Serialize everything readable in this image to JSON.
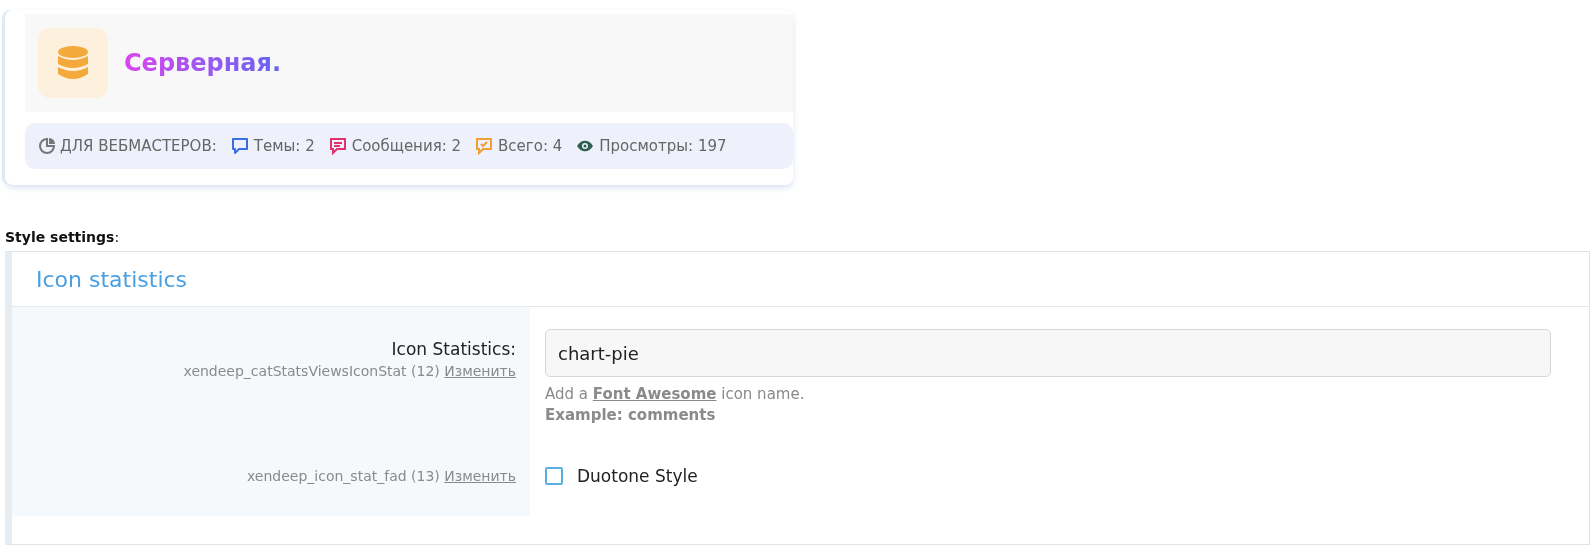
{
  "example": {
    "title": "Серверная.",
    "stats": [
      {
        "kind": "section",
        "label": "ДЛЯ ВЕБМАСТЕРОВ:",
        "color": "#777777"
      },
      {
        "kind": "topics",
        "label": "Темы: 2",
        "color": "#3b6fe0"
      },
      {
        "kind": "messages",
        "label": "Сообщения: 2",
        "color": "#e0336e"
      },
      {
        "kind": "total",
        "label": "Всего: 4",
        "color": "#f0a030"
      },
      {
        "kind": "views",
        "label": "Просмотры: 197",
        "color": "#2f5d50"
      }
    ]
  },
  "style_settings": {
    "heading": "**Style settings**:",
    "panel_title": "Icon statistics",
    "options": [
      {
        "kind": "text",
        "label": "Icon Statistics:",
        "key": "xendeep_catStatsViewsIconStat (12)",
        "edit_link": "Изменить",
        "value": "chart-pie",
        "hint": "Add a **Font Awesome** icon name.",
        "hint_example": "Example: comments"
      },
      {
        "kind": "checkbox",
        "key": "xendeep_icon_stat_fad (13)",
        "edit_link": "Изменить",
        "label": "Duotone Style",
        "checked": false
      }
    ]
  }
}
